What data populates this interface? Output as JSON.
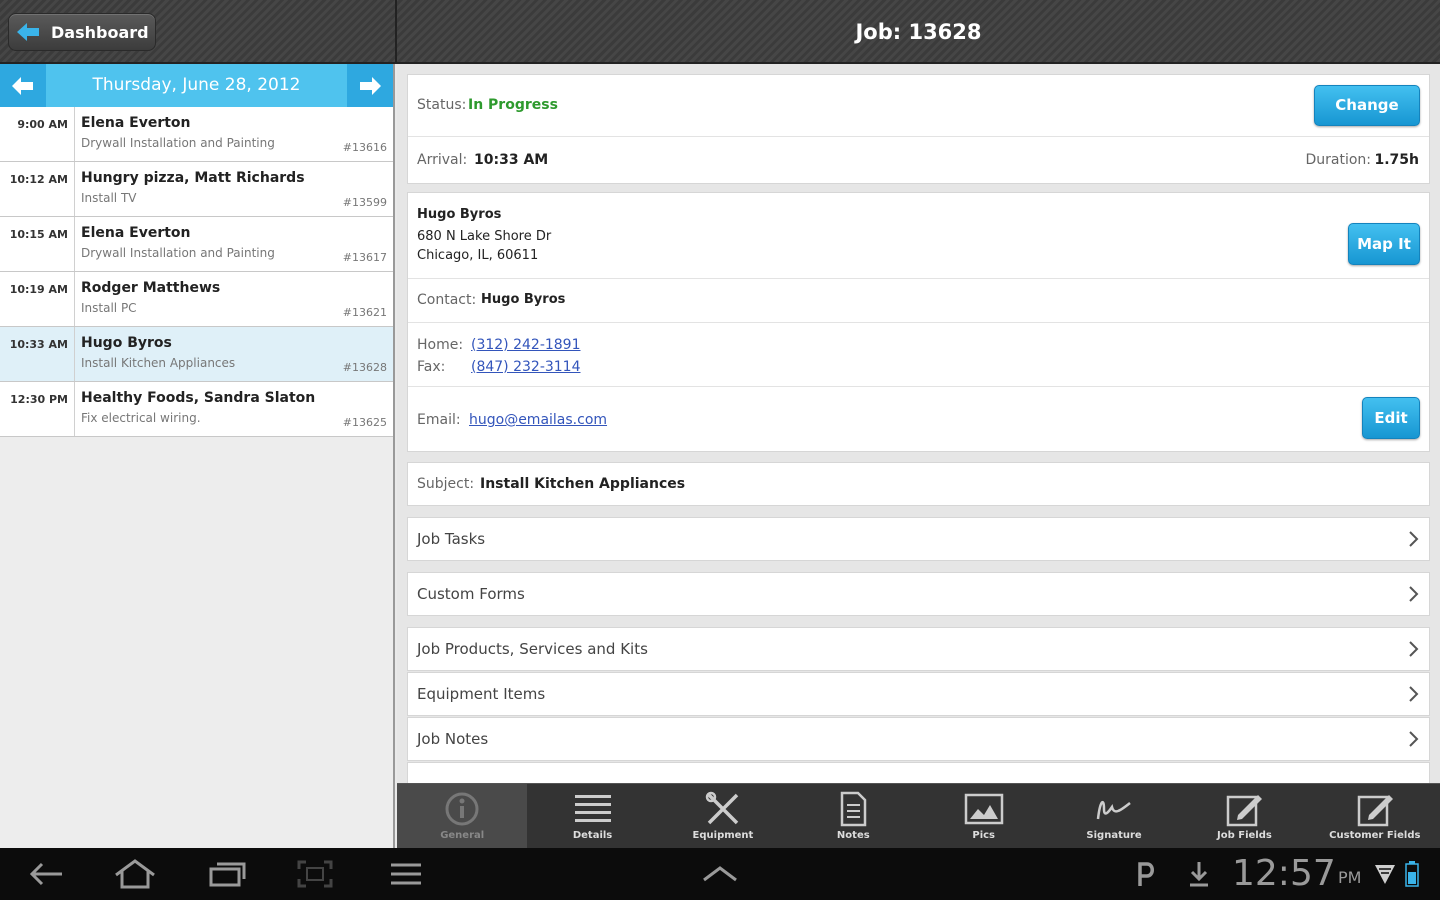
{
  "header": {
    "back_label": "Dashboard",
    "title": "Job: 13628"
  },
  "schedule": {
    "date": "Thursday, June 28, 2012",
    "items": [
      {
        "time": "9:00 AM",
        "name": "Elena Everton",
        "desc": "Drywall Installation and Painting",
        "num": "#13616"
      },
      {
        "time": "10:12 AM",
        "name": "Hungry pizza, Matt Richards",
        "desc": "Install TV",
        "num": "#13599"
      },
      {
        "time": "10:15 AM",
        "name": "Elena Everton",
        "desc": "Drywall Installation and Painting",
        "num": "#13617"
      },
      {
        "time": "10:19 AM",
        "name": "Rodger Matthews",
        "desc": "Install PC",
        "num": "#13621"
      },
      {
        "time": "10:33 AM",
        "name": "Hugo Byros",
        "desc": "Install Kitchen Appliances",
        "num": "#13628"
      },
      {
        "time": "12:30 PM",
        "name": "Healthy Foods, Sandra Slaton",
        "desc": "Fix electrical wiring.",
        "num": "#13625"
      }
    ],
    "selected_index": 4
  },
  "job": {
    "status_label": "Status:",
    "status_value": "In Progress",
    "status_color": "#2e9a2e",
    "change_button": "Change",
    "arrival_label": "Arrival:",
    "arrival_value": "10:33 AM",
    "duration_label": "Duration:",
    "duration_value": "1.75h",
    "customer_name": "Hugo Byros",
    "address_line1": "680 N Lake Shore Dr",
    "address_line2": "Chicago, IL, 60611",
    "map_button": "Map It",
    "contact_label": "Contact:",
    "contact_value": "Hugo Byros",
    "home_label": "Home:",
    "home_value": "(312) 242-1891",
    "fax_label": "Fax:",
    "fax_value": "(847) 232-3114",
    "email_label": "Email:",
    "email_value": "hugo@emailas.com",
    "edit_button": "Edit",
    "subject_label": "Subject:",
    "subject_value": "Install Kitchen Appliances"
  },
  "sections": [
    "Job Tasks",
    "Custom Forms",
    "Job Products, Services and Kits",
    "Equipment Items",
    "Job Notes"
  ],
  "toolbar": {
    "items": [
      {
        "label": "General",
        "icon": "info-icon"
      },
      {
        "label": "Details",
        "icon": "list-icon"
      },
      {
        "label": "Equipment",
        "icon": "tools-icon"
      },
      {
        "label": "Notes",
        "icon": "document-icon"
      },
      {
        "label": "Pics",
        "icon": "picture-icon"
      },
      {
        "label": "Signature",
        "icon": "signature-icon"
      },
      {
        "label": "Job Fields",
        "icon": "edit-icon"
      },
      {
        "label": "Customer Fields",
        "icon": "edit-icon"
      }
    ],
    "active_index": 0
  },
  "system": {
    "time": "12:57",
    "ampm": "PM"
  },
  "colors": {
    "accent": "#4fc3ee",
    "accent_dark": "#2ea8e0",
    "status_green": "#2e9a2e"
  }
}
